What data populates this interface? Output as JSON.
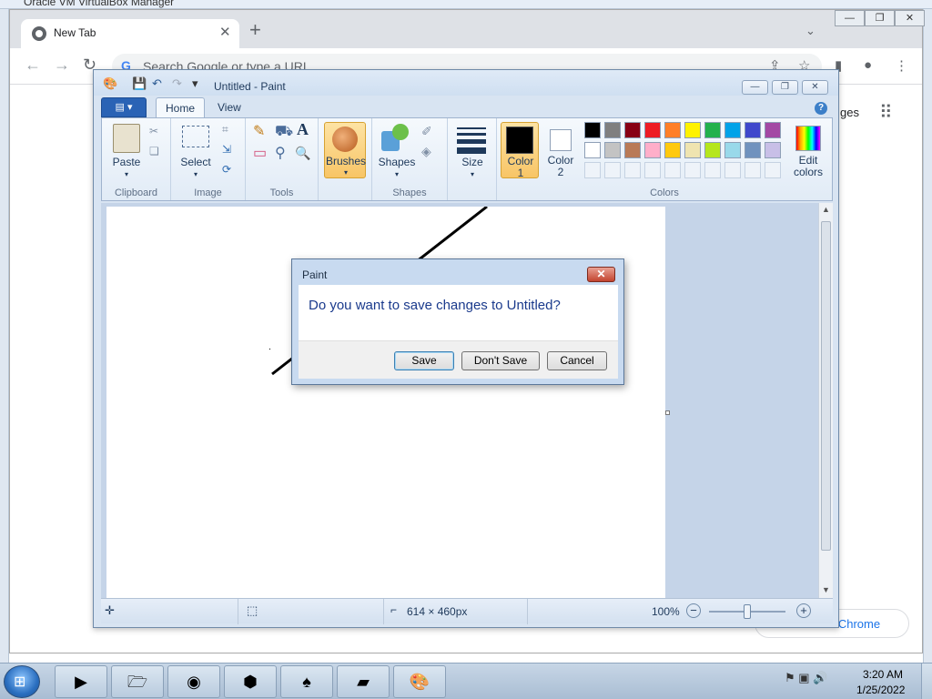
{
  "vbox": {
    "title": "Oracle VM VirtualBox Manager"
  },
  "chrome": {
    "tab_title": "New Tab",
    "tab_close": "✕",
    "new_tab": "+",
    "tab_dropdown": "⌄",
    "win_minimize": "—",
    "win_restore": "❐",
    "win_close": "✕",
    "back": "←",
    "forward": "→",
    "reload": "↻",
    "omnibox_g": "G",
    "omnibox_placeholder": "Search Google or type a URL",
    "share": "⇪",
    "star": "☆",
    "sidepanel": "▮",
    "profile": "●",
    "menu": "⋮",
    "images_link": "ges",
    "apps": "⠿",
    "customize_label": "e Chrome"
  },
  "paint": {
    "title": "Untitled - Paint",
    "qat_save": "💾",
    "qat_undo": "↶",
    "qat_redo": "↷",
    "qat_dropdown": "▾",
    "win_minimize": "—",
    "win_restore": "❐",
    "win_close": "✕",
    "app_menu": "▤ ▾",
    "tabs": [
      "Home",
      "View"
    ],
    "help": "?",
    "groups": {
      "clipboard": "Clipboard",
      "image": "Image",
      "tools": "Tools",
      "shapes": "Shapes",
      "colors": "Colors"
    },
    "buttons": {
      "paste": "Paste",
      "paste_arrow": "▾",
      "cut": "✂",
      "copy": "❏",
      "select": "Select",
      "select_arrow": "▾",
      "crop": "⌗",
      "resize": "⇲",
      "rotate": "⟳",
      "pencil": "✎",
      "fill": "⛟",
      "text": "A",
      "eraser": "▭",
      "picker": "⚲",
      "magnifier": "🔍",
      "brushes": "Brushes",
      "brushes_arrow": "▾",
      "shapes": "Shapes",
      "shapes_arrow": "▾",
      "outline": "✐",
      "fill_shape": "◈",
      "size": "Size",
      "size_arrow": "▾",
      "color1": "Color\n1",
      "color2": "Color\n2",
      "edit_colors": "Edit\ncolors"
    },
    "palette_row1": [
      "#000000",
      "#7f7f7f",
      "#880015",
      "#ed1c24",
      "#ff7f27",
      "#fff200",
      "#22b14c",
      "#00a2e8",
      "#3f48cc",
      "#a349a4"
    ],
    "palette_row2": [
      "#ffffff",
      "#c3c3c3",
      "#b97a57",
      "#ffaec9",
      "#ffc90e",
      "#efe4b0",
      "#b5e61d",
      "#99d9ea",
      "#7092be",
      "#c8bfe7"
    ],
    "status": {
      "canvas_size": "614 × 460px",
      "zoom": "100%",
      "zoom_out": "−",
      "zoom_in": "+"
    }
  },
  "dialog": {
    "title": "Paint",
    "close": "✕",
    "message": "Do you want to save changes to Untitled?",
    "save": "Save",
    "dont_save": "Don't Save",
    "cancel": "Cancel"
  },
  "taskbar": {
    "start": "⊞",
    "apps": [
      {
        "name": "media-player",
        "glyph": "▶"
      },
      {
        "name": "explorer",
        "glyph": "🗁"
      },
      {
        "name": "chrome",
        "glyph": "◉"
      },
      {
        "name": "virtualbox",
        "glyph": "⬢"
      },
      {
        "name": "solitaire",
        "glyph": "♠"
      },
      {
        "name": "sticky-notes",
        "glyph": "▰"
      },
      {
        "name": "paint",
        "glyph": "🎨"
      }
    ],
    "tray_icons": "⚑ ▣ 🔊",
    "time": "3:20 AM",
    "date": "1/25/2022"
  }
}
